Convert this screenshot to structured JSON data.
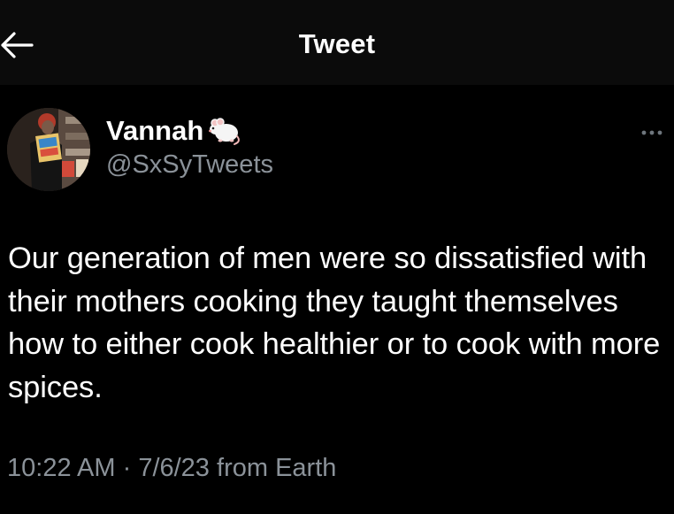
{
  "header": {
    "title": "Tweet",
    "back_icon": "arrow-left-icon"
  },
  "author": {
    "name": "Vannah",
    "name_emoji": "rat-emoji",
    "handle": "@SxSyTweets"
  },
  "tweet": {
    "text": "Our generation of men were so dissatisfied with their mothers cooking they taught themselves how to either cook healthier or to cook with more spices.",
    "time": "10:22 AM",
    "separator": " · ",
    "date": "7/6/23",
    "source": " from Earth"
  },
  "more_icon": "more-horizontal-icon",
  "colors": {
    "background": "#000000",
    "header_background": "#0b0b0b",
    "primary_text": "#ffffff",
    "secondary_text": "#8b9299"
  }
}
